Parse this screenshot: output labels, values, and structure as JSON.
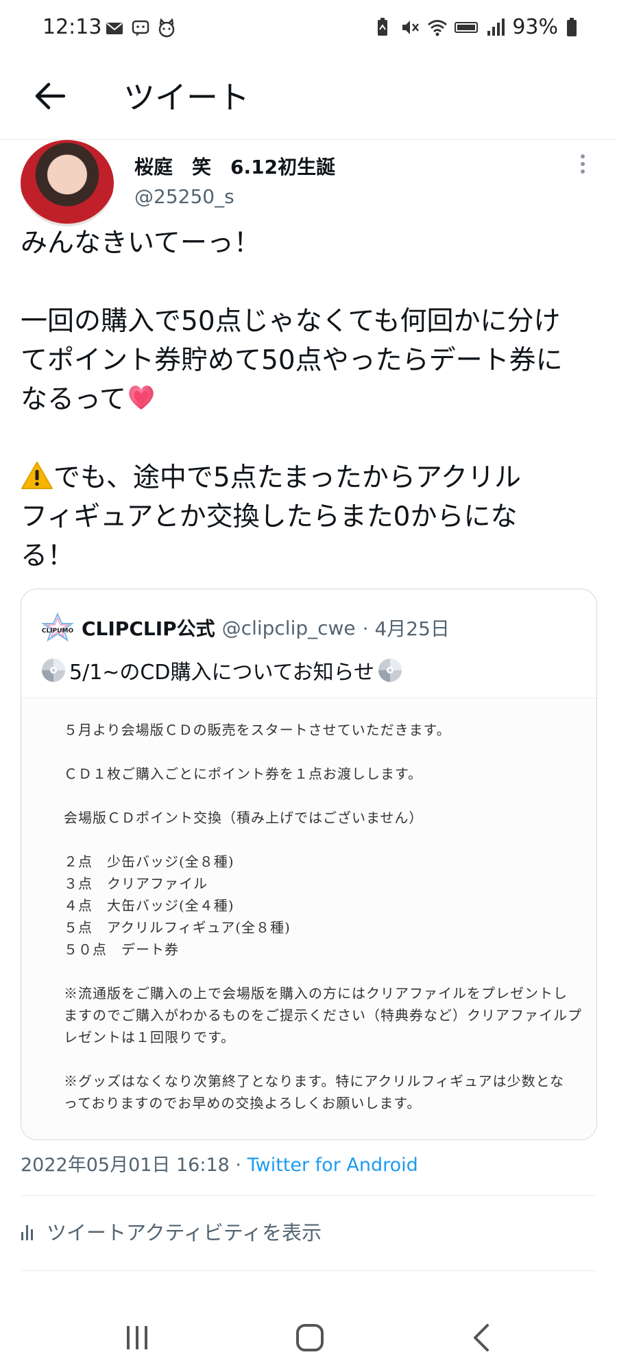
{
  "status_bar": {
    "time": "12:13",
    "battery": "93%",
    "left_icons": [
      "mail-icon",
      "chat-icon",
      "cat-icon"
    ],
    "right_icons": [
      "battery-saver-icon",
      "mute-icon",
      "wifi-icon",
      "volte-icon",
      "signal-icon",
      "battery-icon"
    ]
  },
  "app_bar": {
    "title": "ツイート"
  },
  "tweet": {
    "author": {
      "display_name": "桜庭　笑　6.12初生誕",
      "handle": "@25250_s"
    },
    "body_lines": [
      "みんなきいてーっ！",
      "一回の購入で50点じゃなくても何回かに分け",
      "てポイント券貯めて50点やったらデート券に",
      "なるって",
      "でも、途中で5点たまったからアクリル",
      "フィギュアとか交換したらまた0からにな",
      "る！"
    ],
    "timestamp": "2022年05月01日 16:18",
    "separator": "·",
    "source": "Twitter for Android",
    "activity_label": "ツイートアクティビティを表示"
  },
  "quote": {
    "name": "CLIPCLIP公式",
    "handle": "@clipclip_cwe",
    "date": "· 4月25日",
    "logo_text": "CLIPUMO",
    "text": "5/1~のCD購入についてお知らせ",
    "image_lines": [
      "５月より会場版ＣＤの販売をスタートさせていただきます。",
      "ＣＤ１枚ご購入ごとにポイント券を１点お渡しします。",
      "会場版ＣＤポイント交換（積み上げではございません）",
      "２点　少缶バッジ(全８種)",
      "３点　クリアファイル",
      "４点　大缶バッジ(全４種)",
      "５点　アクリルフィギュア(全８種)",
      "５０点　デート券",
      "※流通版をご購入の上で会場版を購入の方にはクリアファイルをプレゼントし",
      "ますのでご購入がわかるものをご提示ください（特典券など）クリアファイルプ",
      "レゼントは１回限りです。",
      "※グッズはなくなり次第終了となります。特にアクリルフィギュアは少数とな",
      "っておりますのでお早めの交換よろしくお願いします。"
    ]
  },
  "colors": {
    "link": "#1d9bf0",
    "muted": "#536471",
    "text": "#0f1419",
    "border": "#cfd9de"
  }
}
